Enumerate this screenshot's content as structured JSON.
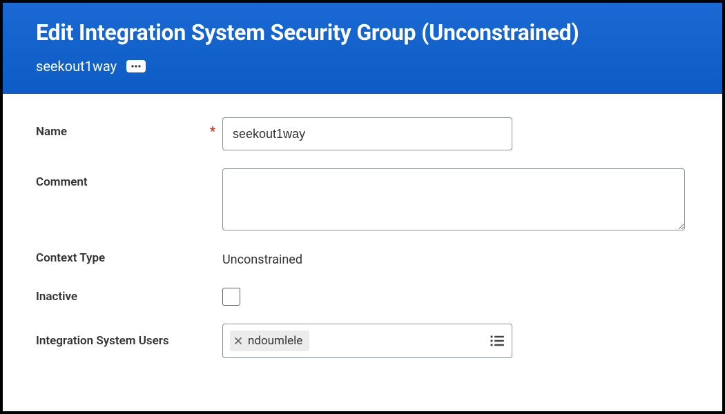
{
  "header": {
    "title": "Edit Integration System Security Group (Unconstrained)",
    "subtitle": "seekout1way"
  },
  "form": {
    "name_label": "Name",
    "name_value": "seekout1way",
    "required_mark": "*",
    "comment_label": "Comment",
    "comment_value": "",
    "context_type_label": "Context Type",
    "context_type_value": "Unconstrained",
    "inactive_label": "Inactive",
    "isu_label": "Integration System Users",
    "isu_chip": "ndoumlele"
  }
}
